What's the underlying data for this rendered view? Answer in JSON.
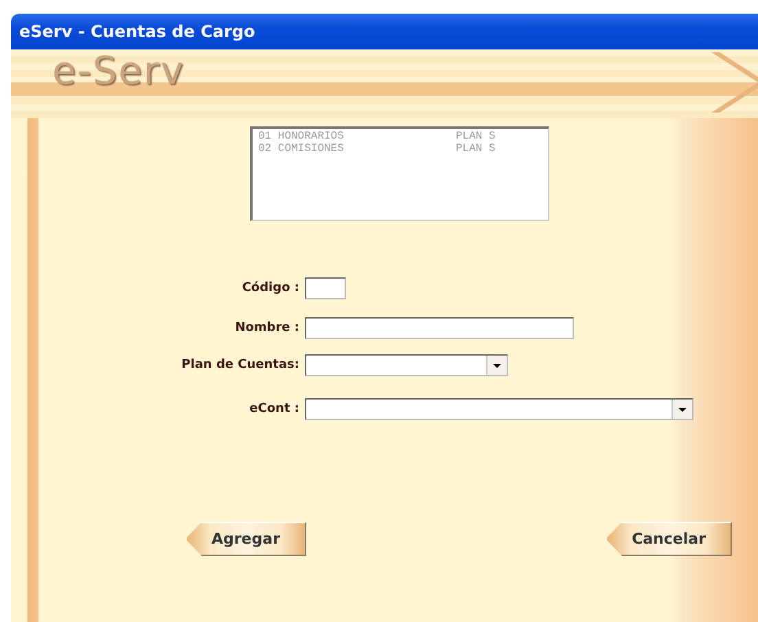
{
  "window": {
    "title": "eServ - Cuentas de Cargo"
  },
  "banner": {
    "logo": "e-Serv"
  },
  "list": {
    "rows": [
      {
        "code": "01 HONORARIOS",
        "plan": "PLAN S"
      },
      {
        "code": "02 COMISIONES",
        "plan": "PLAN S"
      }
    ]
  },
  "fields": [
    {
      "label": "Código :",
      "kind": "text"
    },
    {
      "label": "Nombre :",
      "kind": "text"
    },
    {
      "label": "Plan de Cuentas:",
      "kind": "select"
    },
    {
      "label": "eCont :",
      "kind": "select"
    }
  ],
  "buttons": [
    "Agregar",
    "Cancelar"
  ]
}
